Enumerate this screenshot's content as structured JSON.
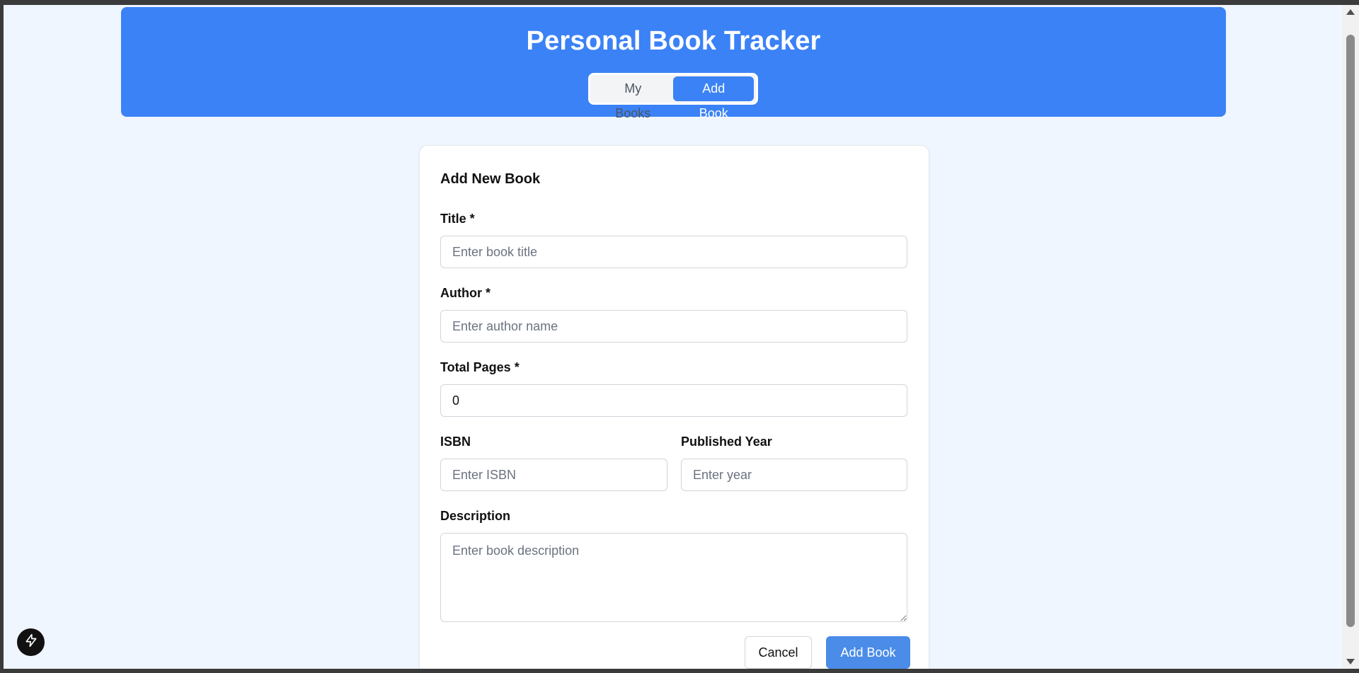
{
  "app": {
    "title": "Personal Book Tracker",
    "tabs": [
      {
        "label": "My Books",
        "active": false
      },
      {
        "label": "Add Book",
        "active": true
      }
    ]
  },
  "form": {
    "title": "Add New Book",
    "fields": {
      "title": {
        "label": "Title *",
        "placeholder": "Enter book title",
        "value": ""
      },
      "author": {
        "label": "Author *",
        "placeholder": "Enter author name",
        "value": ""
      },
      "total_pages": {
        "label": "Total Pages *",
        "placeholder": "",
        "value": "0"
      },
      "isbn": {
        "label": "ISBN",
        "placeholder": "Enter ISBN",
        "value": ""
      },
      "published_year": {
        "label": "Published Year",
        "placeholder": "Enter year",
        "value": ""
      },
      "description": {
        "label": "Description",
        "placeholder": "Enter book description",
        "value": ""
      }
    },
    "buttons": {
      "cancel": "Cancel",
      "submit": "Add Book"
    }
  },
  "colors": {
    "primary": "#3b82f6",
    "background": "#eff6ff",
    "submit_button": "#4a8ce8"
  },
  "floating_button": {
    "icon": "lightning-icon"
  }
}
